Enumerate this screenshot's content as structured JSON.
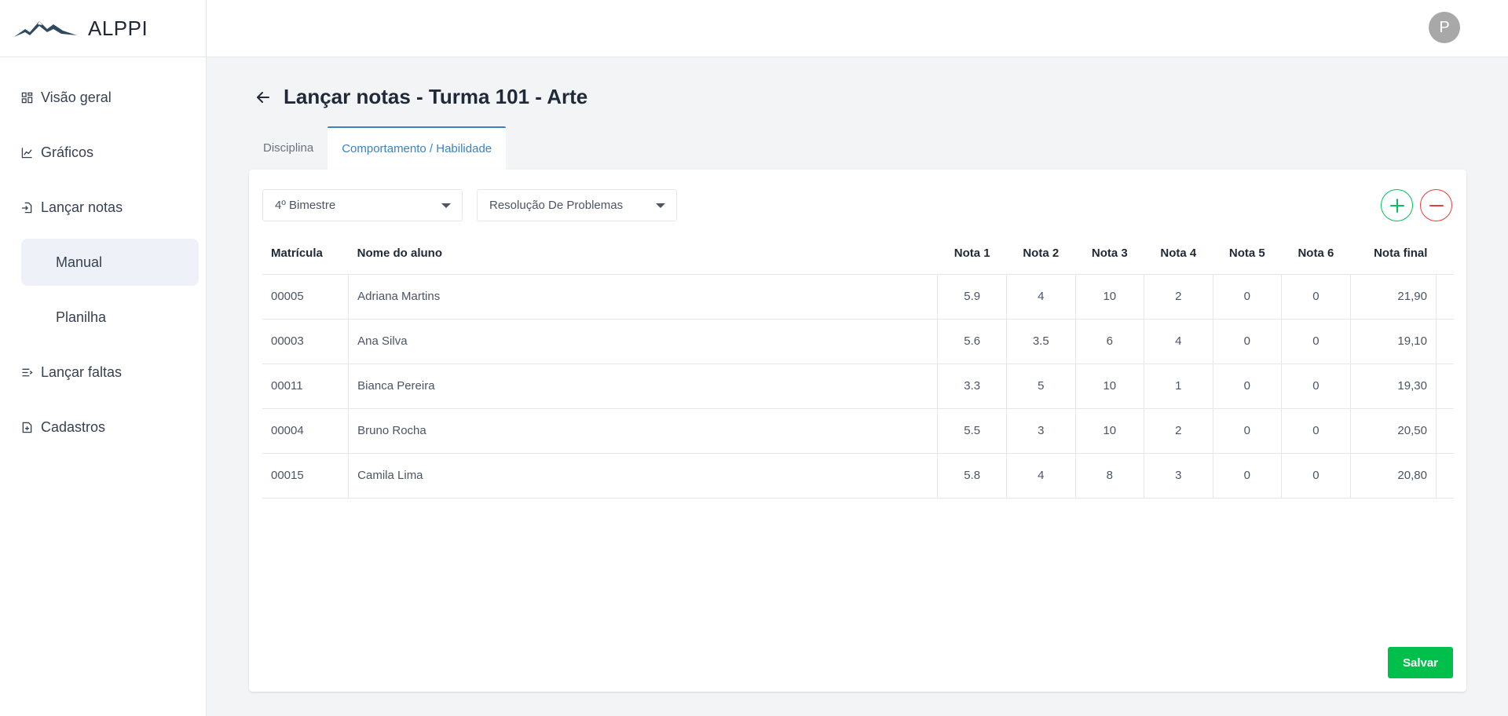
{
  "brand": {
    "name": "ALPPI",
    "logo_icon": "mountains-logo"
  },
  "sidebar": {
    "items": [
      {
        "label": "Visão geral",
        "icon": "dashboard-icon"
      },
      {
        "label": "Gráficos",
        "icon": "chart-icon"
      },
      {
        "label": "Lançar notas",
        "icon": "file-input-icon"
      },
      {
        "label": "Lançar faltas",
        "icon": "list-icon"
      },
      {
        "label": "Cadastros",
        "icon": "file-plus-icon"
      }
    ],
    "sub_items": [
      {
        "label": "Manual",
        "active": true
      },
      {
        "label": "Planilha",
        "active": false
      }
    ]
  },
  "topbar": {
    "avatar_initial": "P"
  },
  "page": {
    "title": "Lançar notas - Turma 101 - Arte"
  },
  "tabs": [
    {
      "label": "Disciplina",
      "active": false
    },
    {
      "label": "Comportamento / Habilidade",
      "active": true
    }
  ],
  "filters": {
    "period": "4º Bimestre",
    "skill": "Resolução De Problemas"
  },
  "table": {
    "headers": [
      "Matrícula",
      "Nome do aluno",
      "Nota 1",
      "Nota 2",
      "Nota 3",
      "Nota 4",
      "Nota 5",
      "Nota 6",
      "Nota final"
    ],
    "rows": [
      [
        "00005",
        "Adriana Martins",
        "5.9",
        "4",
        "10",
        "2",
        "0",
        "0",
        "21,90"
      ],
      [
        "00003",
        "Ana Silva",
        "5.6",
        "3.5",
        "6",
        "4",
        "0",
        "0",
        "19,10"
      ],
      [
        "00011",
        "Bianca Pereira",
        "3.3",
        "5",
        "10",
        "1",
        "0",
        "0",
        "19,30"
      ],
      [
        "00004",
        "Bruno Rocha",
        "5.5",
        "3",
        "10",
        "2",
        "0",
        "0",
        "20,50"
      ],
      [
        "00015",
        "Camila Lima",
        "5.8",
        "4",
        "8",
        "3",
        "0",
        "0",
        "20,80"
      ]
    ]
  },
  "actions": {
    "save_label": "Salvar"
  },
  "colors": {
    "accent": "#3b82c4",
    "add": "#00c060",
    "remove": "#e53e3e",
    "save": "#00c04b"
  }
}
